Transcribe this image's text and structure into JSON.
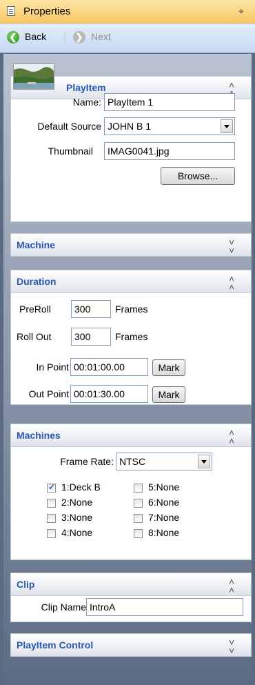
{
  "titlebar": {
    "title": "Properties",
    "icon": "document-icon",
    "pin_icon": "pin-icon"
  },
  "nav": {
    "back_label": "Back",
    "next_label": "Next"
  },
  "playitem": {
    "header": "PlayItem",
    "name_label": "Name:",
    "name_value": "PlayItem 1",
    "source_label": "Default Source",
    "source_value": "JOHN B 1",
    "thumb_label": "Thumbnail",
    "thumb_value": "IMAG0041.jpg",
    "browse_label": "Browse..."
  },
  "machine": {
    "header": "Machine"
  },
  "duration": {
    "header": "Duration",
    "preroll_label": "PreRoll",
    "preroll_value": "300",
    "preroll_unit": "Frames",
    "rollout_label": "Roll Out",
    "rollout_value": "300",
    "rollout_unit": "Frames",
    "inpoint_label": "In Point",
    "inpoint_value": "00:01:00.00",
    "outpoint_label": "Out Point",
    "outpoint_value": "00:01:30.00",
    "mark_label": "Mark"
  },
  "machines": {
    "header": "Machines",
    "framerate_label": "Frame Rate:",
    "framerate_value": "NTSC",
    "slots": [
      {
        "label": "1:Deck B",
        "checked": true
      },
      {
        "label": "2:None",
        "checked": false
      },
      {
        "label": "3:None",
        "checked": false
      },
      {
        "label": "4:None",
        "checked": false
      },
      {
        "label": "5:None",
        "checked": false
      },
      {
        "label": "6:None",
        "checked": false
      },
      {
        "label": "7:None",
        "checked": false
      },
      {
        "label": "8:None",
        "checked": false
      }
    ]
  },
  "clip": {
    "header": "Clip",
    "name_label": "Clip Name",
    "name_value": "IntroA"
  },
  "playitem_control": {
    "header": "PlayItem Control"
  }
}
